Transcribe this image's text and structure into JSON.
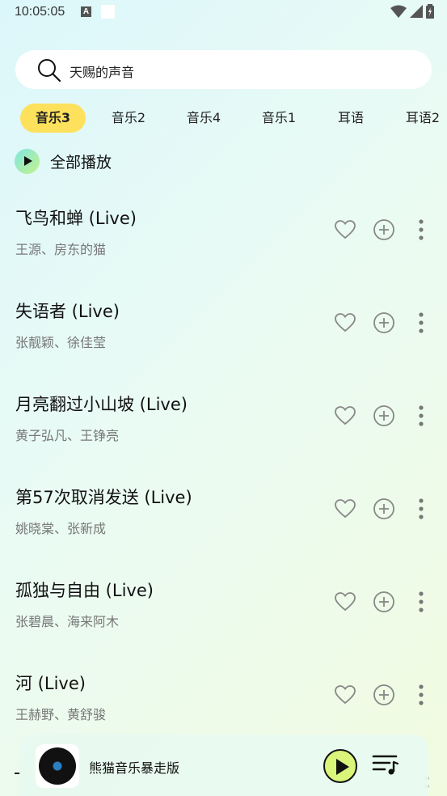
{
  "status_bar": {
    "time": "10:05:05",
    "a_icon": "A"
  },
  "search": {
    "query": "天赐的声音"
  },
  "tabs": [
    {
      "label": "音乐3",
      "active": true
    },
    {
      "label": "音乐2",
      "active": false
    },
    {
      "label": "音乐4",
      "active": false
    },
    {
      "label": "音乐1",
      "active": false
    },
    {
      "label": "耳语",
      "active": false
    },
    {
      "label": "耳语2",
      "active": false
    }
  ],
  "play_all": {
    "label": "全部播放"
  },
  "songs": [
    {
      "title": "飞鸟和蝉 (Live)",
      "artist": "王源、房东的猫"
    },
    {
      "title": "失语者 (Live)",
      "artist": "张靓颖、徐佳莹"
    },
    {
      "title": "月亮翻过小山坡 (Live)",
      "artist": "黄子弘凡、王铮亮"
    },
    {
      "title": "第57次取消发送 (Live)",
      "artist": "姚晓棠、张新成"
    },
    {
      "title": "孤独与自由 (Live)",
      "artist": "张碧晨、海来阿木"
    },
    {
      "title": "河 (Live)",
      "artist": "王赫野、黄舒骏"
    }
  ],
  "player": {
    "title": "熊猫音乐暴走版"
  },
  "colors": {
    "accent": "#fde15d",
    "play_button": "#d9f57a"
  }
}
